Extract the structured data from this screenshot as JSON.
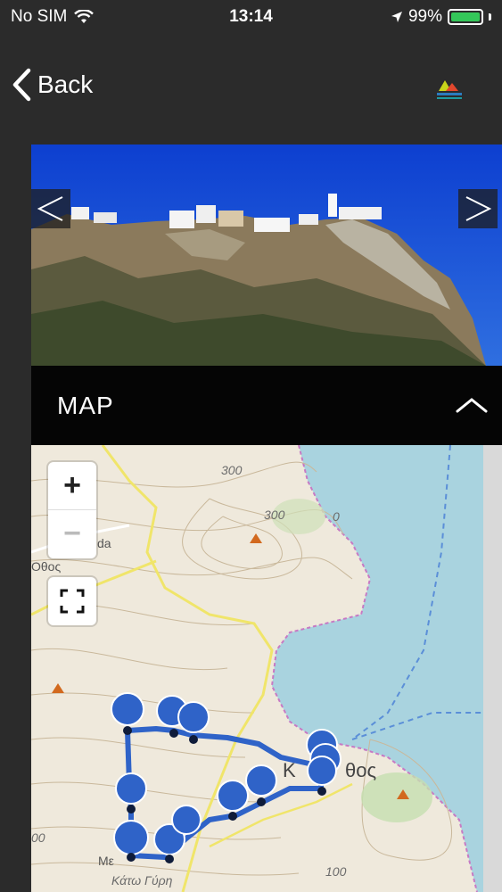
{
  "status": {
    "carrier": "No SIM",
    "time": "13:14",
    "battery": "99%",
    "battery_level": 0.99,
    "battery_color": "#34c759"
  },
  "nav": {
    "back_label": "Back",
    "back_icon": "chevron-left-icon",
    "logo_icon": "mountain-logo-icon"
  },
  "gallery": {
    "prev_icon": "chevron-left-icon",
    "next_icon": "chevron-right-icon"
  },
  "section": {
    "title": "MAP",
    "toggle_icon": "chevron-up-icon"
  },
  "map": {
    "zoom_in": "+",
    "zoom_out": "−",
    "fullscreen_icon": "fullscreen-icon",
    "labels": {
      "contour_300_a": "300",
      "contour_300_b": "300",
      "contour_0": "0",
      "contour_100": "100",
      "contour_00": "00",
      "place_da": "da",
      "place_othos_left": "Οθος",
      "town_main": "Κ",
      "town_main_suffix": "θος",
      "place_me": "Με",
      "place_katw": "Κάτω Γύρη"
    },
    "route_color": "#2f63c8",
    "sea_color": "#a9d3df"
  }
}
